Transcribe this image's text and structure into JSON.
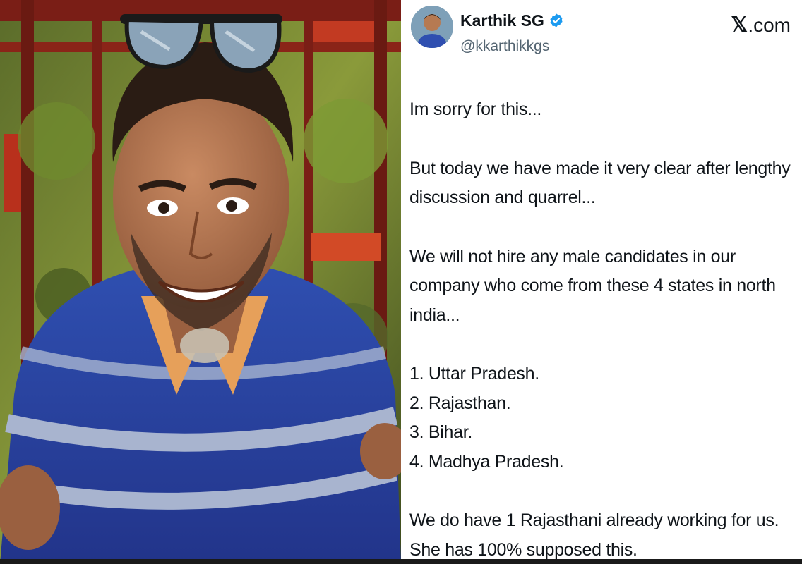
{
  "photo": {
    "description_icon": "person-photo"
  },
  "tweet": {
    "display_name": "Karthik SG",
    "handle": "@kkarthikkgs",
    "brand": ".com",
    "brand_mark": "𝕏",
    "verified_color": "#1d9bf0",
    "lines": [
      "Im sorry for this...",
      "But today we have made it very clear after lengthy",
      "discussion and quarrel...",
      "We will not hire any male candidates in our",
      "company who come from these 4 states in north",
      "india...",
      "1. Uttar Pradesh.",
      "2. Rajasthan.",
      "3. Bihar.",
      "4. Madhya Pradesh.",
      "We do have 1 Rajasthani already working for us.",
      "She has 100% supposed this."
    ]
  }
}
